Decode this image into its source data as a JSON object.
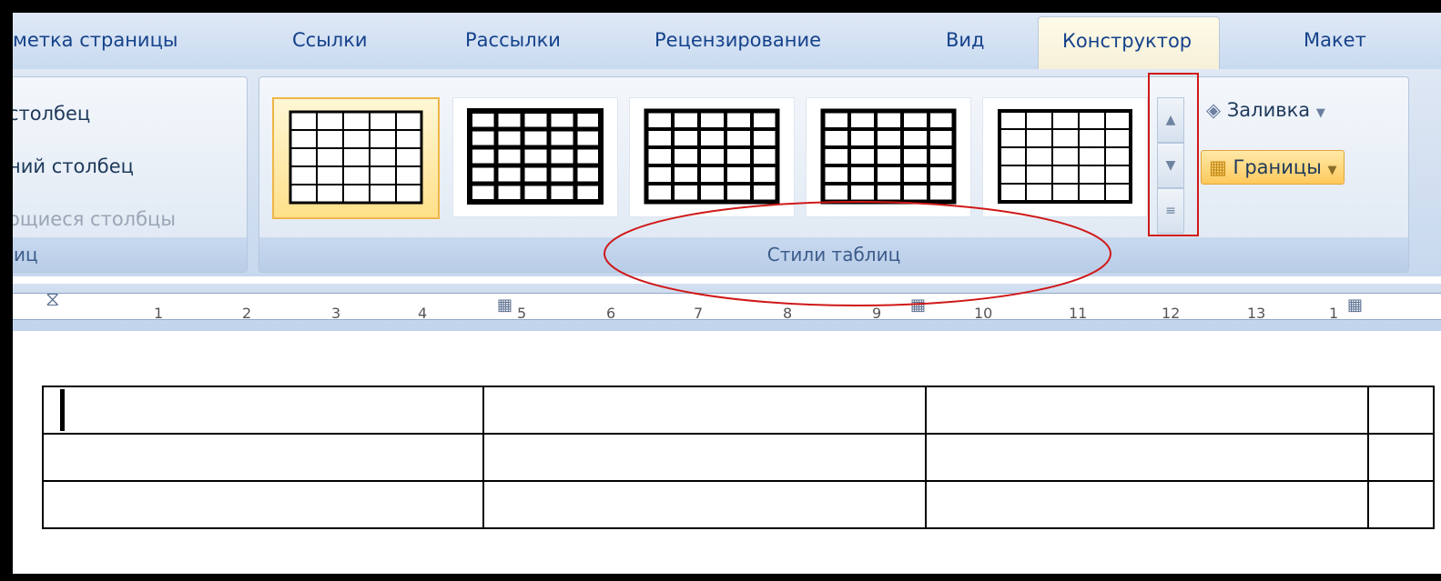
{
  "tabs": [
    "метка страницы",
    "Ссылки",
    "Рассылки",
    "Рецензирование",
    "Вид",
    "Конструктор",
    "Макет"
  ],
  "options_group": {
    "options": [
      "столбец",
      "ний столбец",
      "ощиеся столбцы"
    ],
    "label": "иц"
  },
  "styles_group": {
    "label": "Стили таблиц",
    "selected_index": 0
  },
  "right_group": {
    "fill_label": "Заливка",
    "borders_label": "Границы"
  },
  "ruler": {
    "numbers": [
      "1",
      "2",
      "3",
      "4",
      "5",
      "6",
      "7",
      "8",
      "9",
      "10",
      "11",
      "12",
      "13",
      "1"
    ]
  },
  "document": {
    "table": {
      "rows": 3,
      "cols": 4
    }
  },
  "colors": {
    "annotation": "#d01818",
    "selected_thumbnail": "#ffe08a",
    "tab_text": "#15428b"
  }
}
